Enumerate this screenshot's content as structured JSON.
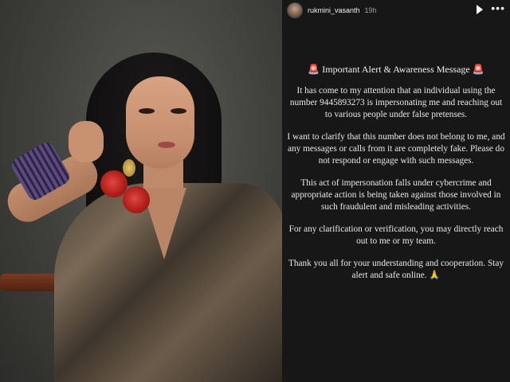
{
  "story": {
    "username": "rukmini_vasanth",
    "time_ago": "19h",
    "icons": {
      "play": "play-icon",
      "more": "more-icon",
      "siren": "rotating-light-icon",
      "pray": "folded-hands-icon"
    },
    "title": "Important Alert & Awareness Message",
    "siren_glyph": "🚨",
    "paragraphs": [
      "It has come to my attention that an individual using the number 9445893273 is impersonating me and reaching out to various people under false pretenses.",
      "I want to clarify that this number does not belong to me, and any messages or calls from it are completely fake. Please do not respond or engage with such messages.",
      "This act of impersonation falls under cybercrime and appropriate action is being taken against those involved in such fraudulent and misleading activities.",
      "For any clarification or verification, you may directly reach out to me or my team.",
      "Thank you all for your understanding and cooperation. Stay alert and safe online. 🙏"
    ]
  },
  "colors": {
    "story_bg": "#171717",
    "text": "#e9e9e9",
    "meta": "#a0a0a0"
  }
}
